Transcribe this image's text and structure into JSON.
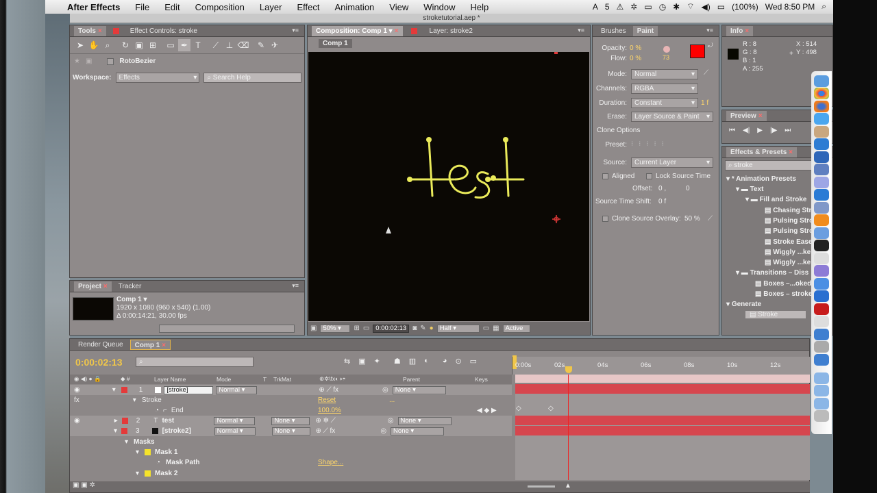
{
  "menubar": {
    "app": "After Effects",
    "items": [
      "File",
      "Edit",
      "Composition",
      "Layer",
      "Effect",
      "Animation",
      "View",
      "Window",
      "Help"
    ],
    "status": {
      "adobe": "5",
      "battery": "(100%)",
      "clock": "Wed 8:50 PM"
    }
  },
  "window": {
    "title": "stroketutorial.aep *"
  },
  "tools": {
    "tab": "Tools",
    "effect_tab": "Effect Controls: stroke",
    "rotobezier": "RotoBezier",
    "workspace_label": "Workspace:",
    "workspace_value": "Effects",
    "search_placeholder": "Search Help"
  },
  "project": {
    "tab": "Project",
    "tracker_tab": "Tracker",
    "comp_name": "Comp 1 ▾",
    "comp_info1": "1920 x 1080  (960 x 540) (1.00)",
    "comp_info2": "Δ 0:00:14:21, 30.00 fps"
  },
  "composition": {
    "tab": "Composition: Comp 1",
    "layer_tab": "Layer: stroke2",
    "crumb": "Comp 1",
    "canvas_text": "test",
    "zoom": "50%",
    "timecode": "0:00:02:13",
    "resolution": "Half",
    "camera": "Active C"
  },
  "paint": {
    "brushes_tab": "Brushes",
    "paint_tab": "Paint",
    "opacity_label": "Opacity:",
    "opacity": "0 %",
    "flow_label": "Flow:",
    "flow": "0 %",
    "brush_size": "73",
    "mode_label": "Mode:",
    "mode": "Normal",
    "channels_label": "Channels:",
    "channels": "RGBA",
    "duration_label": "Duration:",
    "duration": "Constant",
    "duration_frames": "1  f",
    "erase_label": "Erase:",
    "erase": "Layer Source & Paint",
    "clone_options": "Clone Options",
    "preset_label": "Preset:",
    "source_label": "Source:",
    "source": "Current Layer",
    "aligned": "Aligned",
    "lock_source": "Lock Source Time",
    "offset_label": "Offset:",
    "offset_x": "0 ,",
    "offset_y": "0",
    "shift_label": "Source Time Shift:",
    "shift": "0  f",
    "overlay_label": "Clone Source Overlay:",
    "overlay": "50 %",
    "fg_color": "#ff0000",
    "bg_color": "#ffffff"
  },
  "info": {
    "tab": "Info",
    "r": "R : 8",
    "g": "G : 8",
    "b": "B : 1",
    "a": "A : 255",
    "x": "X : 514",
    "y": "Y : 498"
  },
  "preview": {
    "tab": "Preview"
  },
  "effects": {
    "tab": "Effects & Presets",
    "search": "stroke",
    "tree": [
      "* Animation Presets",
      "Text",
      "Fill and Stroke",
      "Chasing Stro",
      "Pulsing Stro",
      "Pulsing Stro",
      "Stroke Ease",
      "Wiggly ...ke",
      "Wiggly ...ke",
      "Transitions – Diss",
      "Boxes –...oked",
      "Boxes – stroke",
      "Generate",
      "Stroke"
    ]
  },
  "timeline": {
    "render_tab": "Render Queue",
    "comp_tab": "Comp 1",
    "timecode": "0:00:02:13",
    "col_layer": "Layer Name",
    "col_mode": "Mode",
    "col_t": "T",
    "col_trkmat": "TrkMat",
    "col_parent": "Parent",
    "col_keys": "Keys",
    "ruler": [
      "0:00s",
      "02s",
      "04s",
      "06s",
      "08s",
      "10s",
      "12s"
    ],
    "rows": [
      {
        "num": "1",
        "name": "[stroke]",
        "mode": "Normal",
        "trkmat": "",
        "parent": "None",
        "color": "#e43a3a"
      },
      {
        "sub": "Stroke",
        "value": "Reset",
        "extra": "..."
      },
      {
        "sub": "End",
        "value": "100.0%"
      },
      {
        "num": "2",
        "name": "test",
        "mode": "Normal",
        "trkmat": "None",
        "parent": "None",
        "color": "#e43a3a"
      },
      {
        "num": "3",
        "name": "[stroke2]",
        "mode": "Normal",
        "trkmat": "None",
        "parent": "None",
        "color": "#e43a3a"
      },
      {
        "sub": "Masks"
      },
      {
        "sub": "Mask 1"
      },
      {
        "sub": "Mask Path",
        "value": "Shape..."
      },
      {
        "sub": "Mask 2"
      }
    ],
    "playhead_seconds": 2.43,
    "duration_seconds": 14.7
  }
}
